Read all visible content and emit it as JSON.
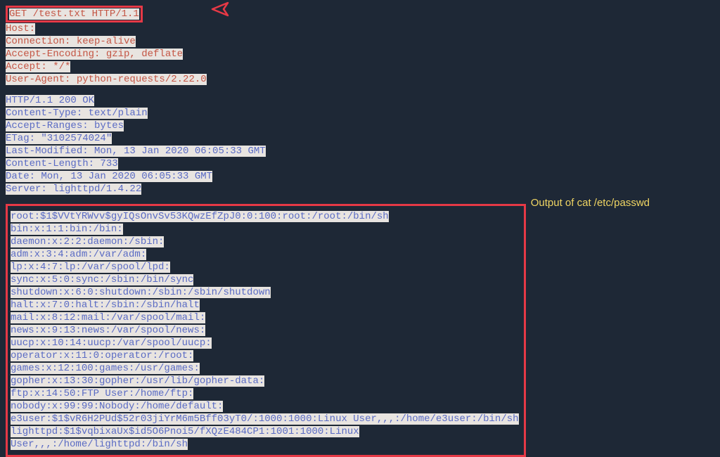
{
  "request": {
    "line1": "GET /test.txt HTTP/1.1",
    "line2": "Host:",
    "line3": "Connection: keep-alive",
    "line4": "Accept-Encoding: gzip, deflate",
    "line5": "Accept: */*",
    "line6": "User-Agent: python-requests/2.22.0"
  },
  "response": {
    "line1": "HTTP/1.1 200 OK",
    "line2": "Content-Type: text/plain",
    "line3": "Accept-Ranges: bytes",
    "line4": "ETag: \"3102574024\"",
    "line5": "Last-Modified: Mon, 13 Jan 2020 06:05:33 GMT",
    "line6": "Content-Length: 733",
    "line7": "Date: Mon, 13 Jan 2020 06:05:33 GMT",
    "line8": "Server: lighttpd/1.4.22"
  },
  "body": {
    "line1": "root:$1$VVtYRWvv$gyIQsOnvSv53KQwzEfZpJ0:0:100:root:/root:/bin/sh",
    "line2": "bin:x:1:1:bin:/bin:",
    "line3": "daemon:x:2:2:daemon:/sbin:",
    "line4": "adm:x:3:4:adm:/var/adm:",
    "line5": "lp:x:4:7:lp:/var/spool/lpd:",
    "line6": "sync:x:5:0:sync:/sbin:/bin/sync",
    "line7": "shutdown:x:6:0:shutdown:/sbin:/sbin/shutdown",
    "line8": "halt:x:7:0:halt:/sbin:/sbin/halt",
    "line9": "mail:x:8:12:mail:/var/spool/mail:",
    "line10": "news:x:9:13:news:/var/spool/news:",
    "line11": "uucp:x:10:14:uucp:/var/spool/uucp:",
    "line12": "operator:x:11:0:operator:/root:",
    "line13": "games:x:12:100:games:/usr/games:",
    "line14": "gopher:x:13:30:gopher:/usr/lib/gopher-data:",
    "line15": "ftp:x:14:50:FTP User:/home/ftp:",
    "line16": "nobody:x:99:99:Nobody:/home/default:",
    "line17": "e3user:$1$vR6H2PUd$52r03jiYrM6m5Bff03yT0/:1000:1000:Linux User,,,:/home/e3user:/bin/sh",
    "line18": "lighttpd:$1$vqbixaUx$id5O6Pnoi5/fXQzE484CP1:1001:1000:Linux User,,,:/home/lighttpd:/bin/sh"
  },
  "annotation": {
    "text": "Output of cat /etc/passwd"
  }
}
